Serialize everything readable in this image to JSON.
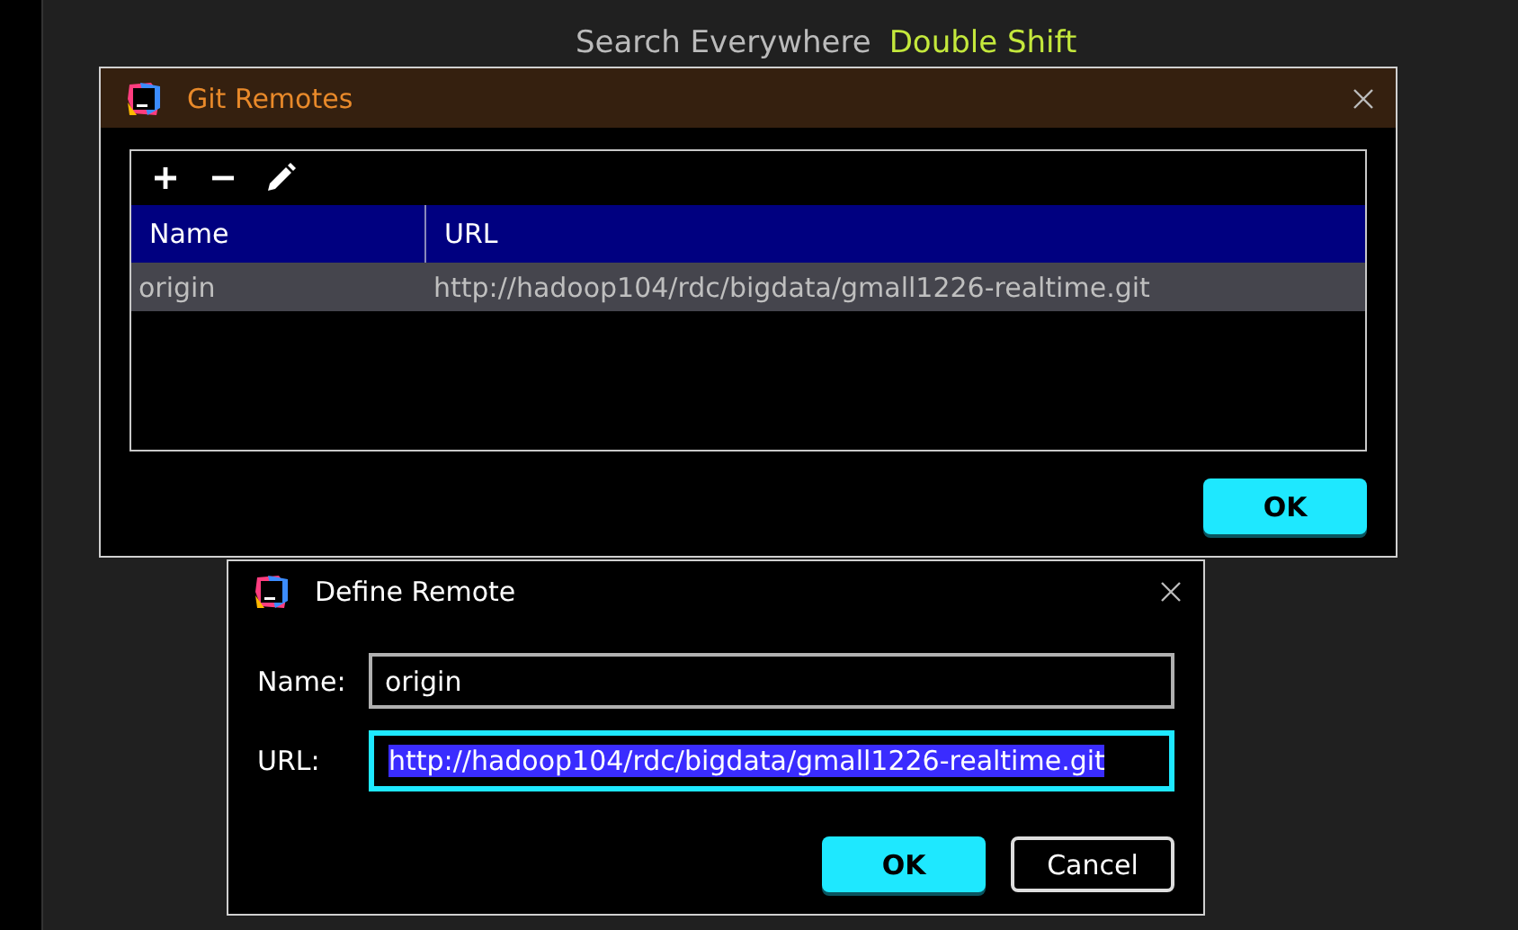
{
  "background_hint": {
    "text": "Search Everywhere",
    "shortcut": "Double Shift"
  },
  "git_remotes_dialog": {
    "title": "Git Remotes",
    "toolbar": [
      {
        "kind": "add"
      },
      {
        "kind": "remove"
      },
      {
        "kind": "edit"
      }
    ],
    "table": {
      "columns": [
        "Name",
        "URL"
      ],
      "rows": [
        {
          "name": "origin",
          "url": "http://hadoop104/rdc/bigdata/gmall1226-realtime.git",
          "selected": true
        }
      ]
    },
    "buttons": [
      "OK"
    ]
  },
  "define_remote_dialog": {
    "title": "Define Remote",
    "fields": [
      {
        "label": "Name:",
        "value": "origin",
        "focused": false,
        "text_selected": false
      },
      {
        "label": "URL:",
        "value": "http://hadoop104/rdc/bigdata/gmall1226-realtime.git",
        "focused": true,
        "text_selected": true
      }
    ],
    "buttons": [
      {
        "label": "OK",
        "kind": "primary"
      },
      {
        "label": "Cancel",
        "kind": "secondary"
      }
    ]
  }
}
